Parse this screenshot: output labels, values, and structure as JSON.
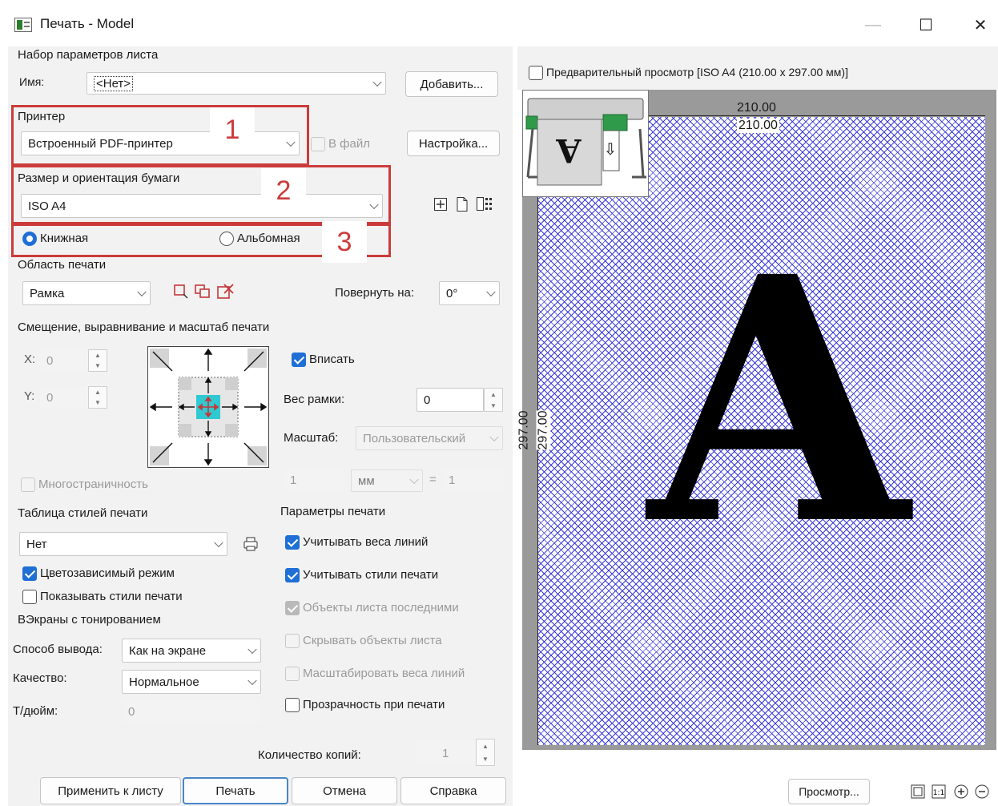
{
  "window": {
    "title": "Печать - Model",
    "minimize": "—",
    "maximize": "☐",
    "close": "✕"
  },
  "page_setup": {
    "group": "Набор параметров листа",
    "name_label": "Имя:",
    "name_value": "<Нет>",
    "add_button": "Добавить..."
  },
  "printer": {
    "group": "Принтер",
    "value": "Встроенный PDF-принтер",
    "to_file_label": "В файл",
    "to_file_checked": false,
    "setup_button": "Настройка..."
  },
  "paper": {
    "group": "Размер и ориентация бумаги",
    "value": "ISO A4"
  },
  "orientation": {
    "portrait": "Книжная",
    "landscape": "Альбомная",
    "selected": "portrait"
  },
  "annotations": {
    "n1": "1",
    "n2": "2",
    "n3": "3"
  },
  "print_area": {
    "group": "Область печати",
    "value": "Рамка",
    "rotate_label": "Повернуть на:",
    "rotate_value": "0°"
  },
  "offset": {
    "group": "Смещение, выравнивание и масштаб печати",
    "x_label": "X:",
    "x_value": "0",
    "y_label": "Y:",
    "y_value": "0",
    "fit_label": "Вписать",
    "fit_checked": true,
    "frame_weight_label": "Вес рамки:",
    "frame_weight_value": "0",
    "scale_label": "Масштаб:",
    "scale_value": "Пользовательский",
    "scale_num": "1",
    "scale_unit": "мм",
    "scale_eq": "=",
    "scale_den": "1",
    "multipage_label": "Многостраничность"
  },
  "style_table": {
    "group": "Таблица стилей печати",
    "value": "Нет",
    "color_dependent": "Цветозависимый режим",
    "show_styles": "Показывать стили печати"
  },
  "shaded": {
    "group": "ВЭкраны с тонированием",
    "output_label": "Способ вывода:",
    "output_value": "Как на экране",
    "quality_label": "Качество:",
    "quality_value": "Нормальное",
    "dpi_label": "Т/дюйм:",
    "dpi_value": "0"
  },
  "print_options": {
    "group": "Параметры печати",
    "items": [
      {
        "label": "Учитывать веса линий",
        "checked": true,
        "disabled": false
      },
      {
        "label": "Учитывать стили печати",
        "checked": true,
        "disabled": false
      },
      {
        "label": "Объекты листа последними",
        "checked": true,
        "disabled": true
      },
      {
        "label": "Скрывать объекты листа",
        "checked": false,
        "disabled": true
      },
      {
        "label": "Масштабировать веса линий",
        "checked": false,
        "disabled": true
      },
      {
        "label": "Прозрачность при печати",
        "checked": false,
        "disabled": false
      }
    ]
  },
  "copies": {
    "label": "Количество копий:",
    "value": "1"
  },
  "buttons": {
    "apply": "Применить к листу",
    "print": "Печать",
    "cancel": "Отмена",
    "help": "Справка",
    "preview": "Просмотр..."
  },
  "preview": {
    "checkbox_label": "Предварительный просмотр [ISO A4 (210.00 x 297.00 мм)]",
    "width_label": "210.00",
    "height_label": "297.00",
    "big_letter": "A",
    "thumb_letter": "A",
    "thumb_arrow": "⇩"
  },
  "colors": {
    "accent": "#1f6fd6",
    "annotation": "#cc3b3b",
    "hatch": "#3a3ad8",
    "preview_bg": "#9a9a9a"
  }
}
